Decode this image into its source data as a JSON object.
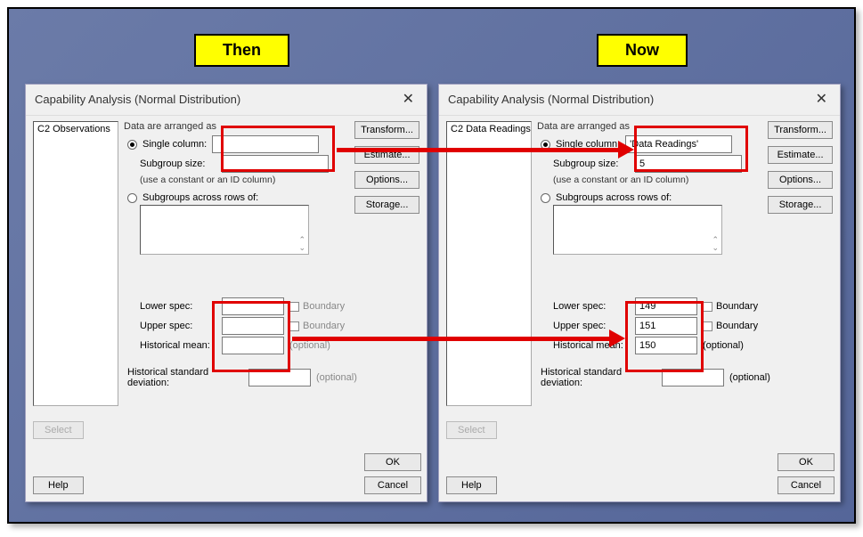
{
  "tags": {
    "then": "Then",
    "now": "Now"
  },
  "dialog": {
    "title": "Capability Analysis (Normal Distribution)",
    "close": "✕",
    "arrange_label": "Data are arranged as",
    "radio_single": "Single column:",
    "subgroup_label": "Subgroup size:",
    "use_note": "(use a constant or an ID column)",
    "radio_across": "Subgroups across rows of:",
    "lower_spec": "Lower spec:",
    "upper_spec": "Upper spec:",
    "hist_mean": "Historical mean:",
    "hist_sd": "Historical standard deviation:",
    "boundary": "Boundary",
    "optional": "(optional)",
    "btn_transform": "Transform...",
    "btn_estimate": "Estimate...",
    "btn_options": "Options...",
    "btn_storage": "Storage...",
    "btn_select": "Select",
    "btn_help": "Help",
    "btn_ok": "OK",
    "btn_cancel": "Cancel"
  },
  "then": {
    "collist": "C2    Observations",
    "single_col": "",
    "subgroup": "",
    "lower": "",
    "upper": "",
    "mean": "",
    "sd": ""
  },
  "now": {
    "collist": "C2    Data Readings",
    "single_col": "'Data Readings'",
    "subgroup": "5",
    "lower": "149",
    "upper": "151",
    "mean": "150",
    "sd": ""
  }
}
